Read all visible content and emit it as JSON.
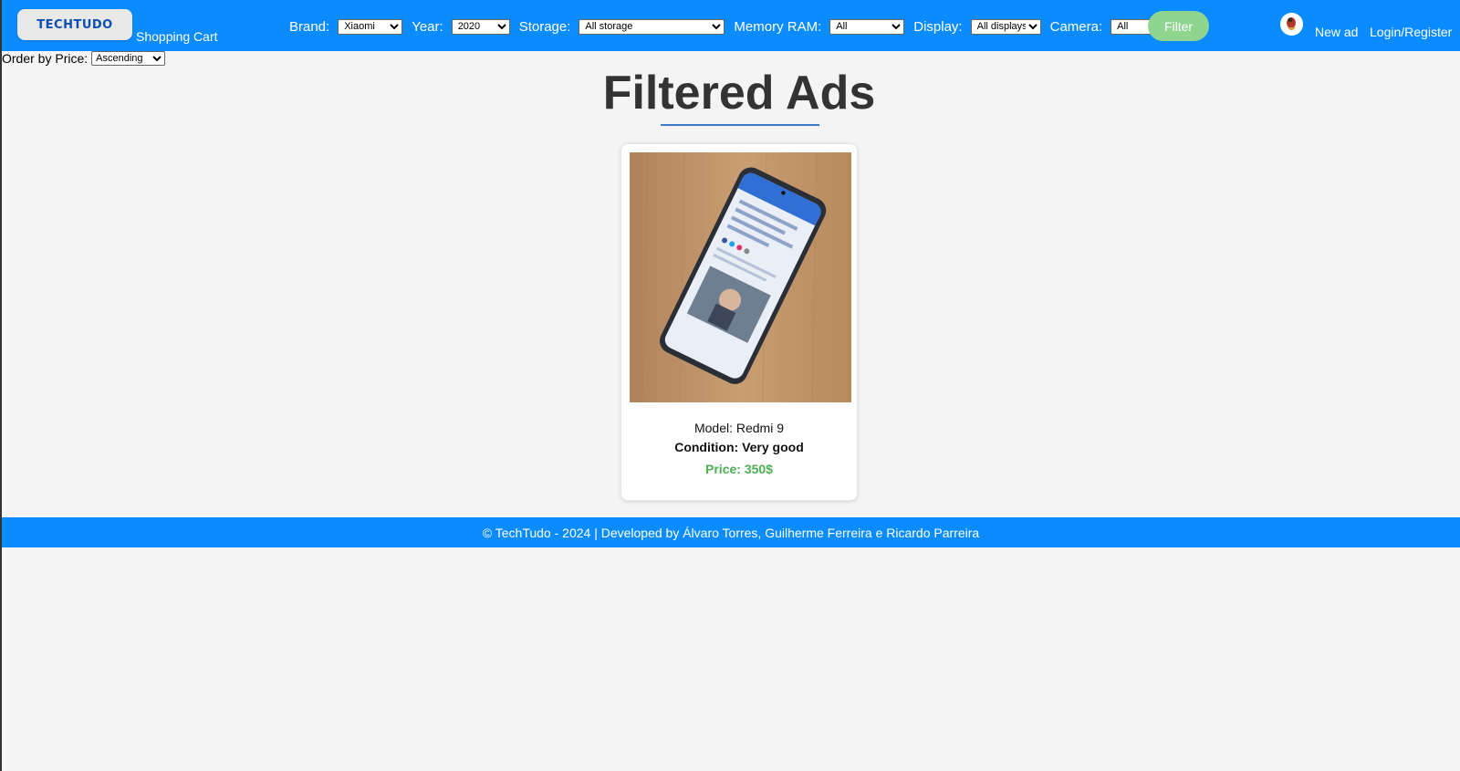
{
  "header": {
    "logo_text": "TECHTUDO",
    "cart_label": "Shopping Cart",
    "filters": [
      {
        "label": "Brand:",
        "selected": "Xiaomi"
      },
      {
        "label": "Year:",
        "selected": "2020"
      },
      {
        "label": "Storage:",
        "selected": "All storage"
      },
      {
        "label": "Memory RAM:",
        "selected": "All"
      },
      {
        "label": "Display:",
        "selected": "All displays"
      },
      {
        "label": "Camera:",
        "selected": "All"
      }
    ],
    "filter_button": "Filter",
    "new_ad_label": "New ad",
    "login_label": "Login/Register"
  },
  "sort": {
    "label": "Order by Price:",
    "selected": "Ascending"
  },
  "main": {
    "title": "Filtered Ads",
    "ads": [
      {
        "model": "Model: Redmi 9",
        "condition": "Condition: Very good",
        "price": "Price: 350$"
      }
    ]
  },
  "footer": {
    "text": "© TechTudo - 2024 | Developed by Álvaro Torres, Guilherme Ferreira e Ricardo Parreira"
  },
  "colors": {
    "header_bg": "#0a8cff",
    "filter_button": "#8fd48f",
    "price": "#4caf50",
    "title_rule": "#3a78c8"
  }
}
